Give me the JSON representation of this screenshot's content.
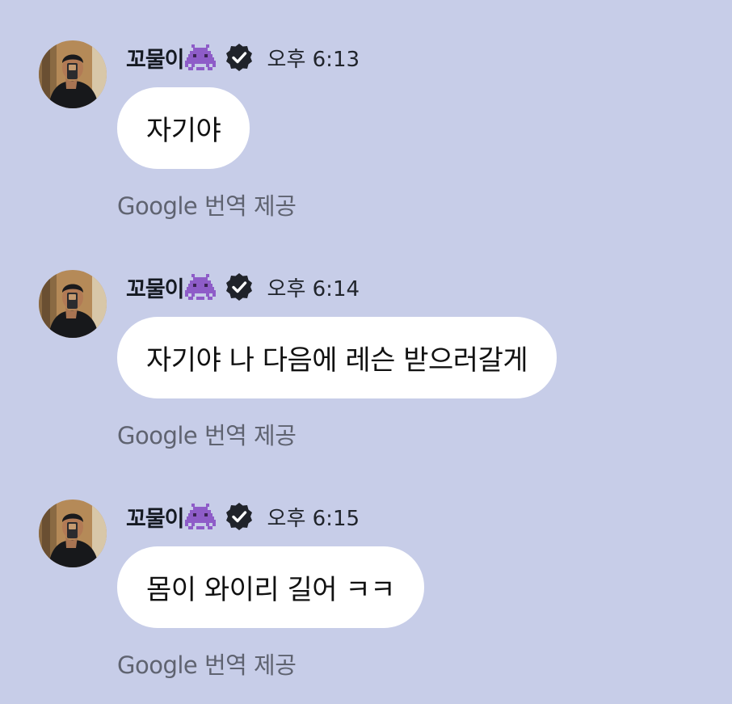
{
  "messages": [
    {
      "sender_name": "꼬물이",
      "time": "오후 6:13",
      "text": "자기야",
      "translation_note": "Google 번역 제공"
    },
    {
      "sender_name": "꼬물이",
      "time": "오후 6:14",
      "text": "자기야 나 다음에 레슨 받으러갈게",
      "translation_note": "Google 번역 제공"
    },
    {
      "sender_name": "꼬물이",
      "time": "오후 6:15",
      "text": "몸이 와이리 길어 ㅋㅋ",
      "translation_note": "Google 번역 제공"
    }
  ],
  "icons": {
    "name_emoji": "alien-monster-icon",
    "badge": "verified-badge-icon"
  },
  "colors": {
    "background": "#c7cde8",
    "bubble": "#ffffff",
    "emoji": "#8e5cc8",
    "badge": "#20232a",
    "translation_text": "#5f6370"
  }
}
